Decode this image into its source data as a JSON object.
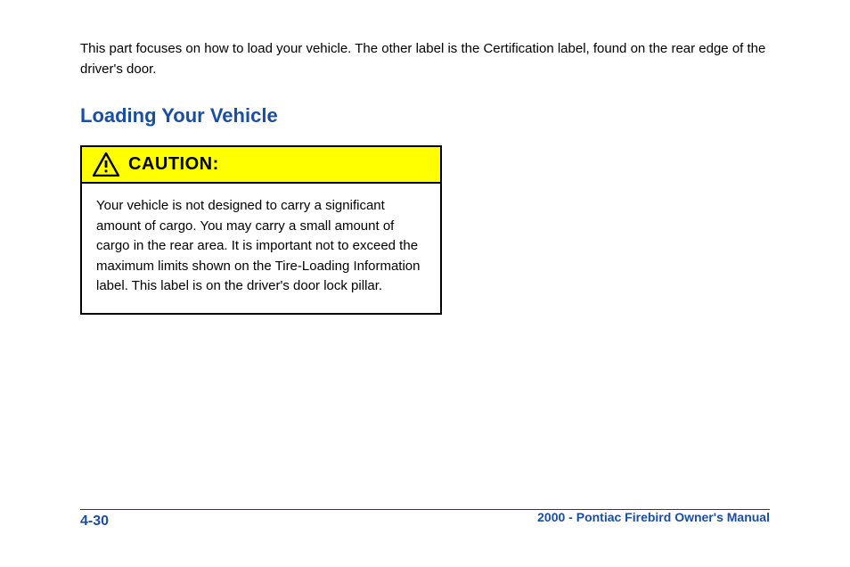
{
  "lead": "This part focuses on how to load your vehicle. The other label is the Certification label, found on the rear edge of the driver's door.",
  "heading": "Loading Your Vehicle",
  "caution_label": "CAUTION:",
  "caution_text": "Your vehicle is not designed to carry a significant amount of cargo. You may carry a small amount of cargo in the rear area. It is important not to exceed the maximum limits shown on the Tire-Loading Information label. This label is on the driver's door lock pillar.",
  "section_ref": "2000 - Pontiac Firebird Owner's Manual",
  "page_num": "4-30"
}
